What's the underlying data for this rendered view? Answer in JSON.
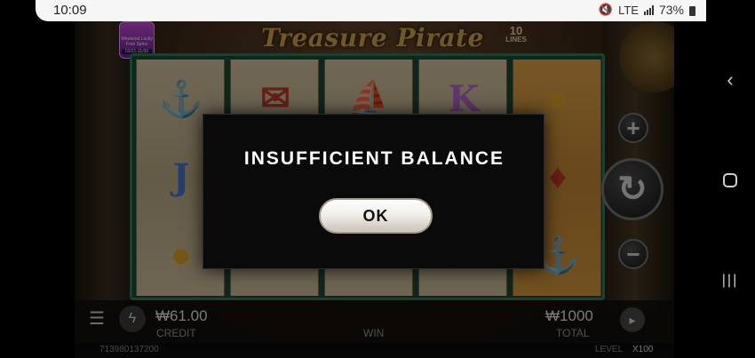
{
  "status_bar": {
    "time": "10:09",
    "network_label": "LTE",
    "battery": "73%",
    "icons": [
      "mute-icon",
      "volte-icon",
      "lte-icon",
      "signal-icon",
      "battery-icon"
    ]
  },
  "game": {
    "logo": "Treasure Pirate",
    "lines": {
      "number": "10",
      "label": "LINES"
    },
    "promo": {
      "text": "Weekend Lucky Free Spins",
      "date": "03/21-11/30"
    },
    "reels": [
      [
        "anchor",
        "J",
        "coins"
      ],
      [
        "scroll",
        "blank",
        "blank"
      ],
      [
        "ship",
        "blank",
        "blank"
      ],
      [
        "K",
        "blank",
        "blank"
      ],
      [
        "coins",
        "treasure",
        "anchor"
      ]
    ],
    "buttons": {
      "plus": "+",
      "minus": "−",
      "spin": "↻",
      "menu": "☰",
      "turbo": "ϟ",
      "autoplay": "▸"
    },
    "bottom": {
      "credit_amount": "₩61.00",
      "credit_label": "CREDIT",
      "win_label": "WIN",
      "total_amount": "₩1000",
      "total_label": "TOTAL"
    },
    "footer": {
      "game_id": "713980137200",
      "level_label": "LEVEL",
      "level_value": "X100"
    }
  },
  "modal": {
    "title": "INSUFFICIENT BALANCE",
    "ok_label": "OK"
  },
  "nav": {
    "back": "‹",
    "recents": "|||"
  }
}
